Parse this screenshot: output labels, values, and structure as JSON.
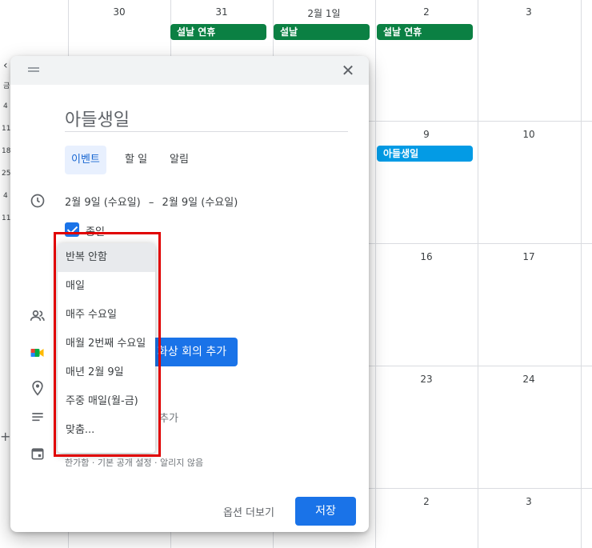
{
  "calendar": {
    "day_numbers": {
      "d30": "30",
      "d31": "31",
      "feb1": "2월 1일",
      "feb2": "2",
      "feb3": "3",
      "d9": "9",
      "d10": "10",
      "d16": "16",
      "d17": "17",
      "d23": "23",
      "d24": "24",
      "w5_2": "2",
      "w5_3": "3"
    },
    "events": {
      "holiday_31": "설날 연휴",
      "holiday_feb1": "설날",
      "holiday_feb2": "설날 연휴",
      "birthday_9": "아들생일"
    },
    "mini_calendar": [
      "금",
      "4",
      "11",
      "18",
      "25",
      "4",
      "11"
    ],
    "colors": {
      "holiday": "#0b8043",
      "event": "#039be5",
      "accent": "#1a73e8"
    }
  },
  "dialog": {
    "title_value": "아들생일",
    "tabs": [
      "이벤트",
      "할 일",
      "알림"
    ],
    "active_tab": "이벤트",
    "date_start": "2월 9일 (수요일)",
    "date_separator": "–",
    "date_end": "2월 9일 (수요일)",
    "all_day_label": "종일",
    "all_day_checked": true,
    "meet_button_label": "화상 회의 추가",
    "description_partial": "명 추가",
    "calendar_subtext": "한가함 · 기본 공개 설정 · 알리지 않음",
    "more_options_label": "옵션 더보기",
    "save_label": "저장",
    "close_icon": "close-icon"
  },
  "repeat_dropdown": {
    "selected": "반복 안함",
    "options": [
      "반복 안함",
      "매일",
      "매주 수요일",
      "매월 2번째 수요일",
      "매년 2월 9일",
      "주중 매일(월-금)",
      "맞춤..."
    ]
  }
}
